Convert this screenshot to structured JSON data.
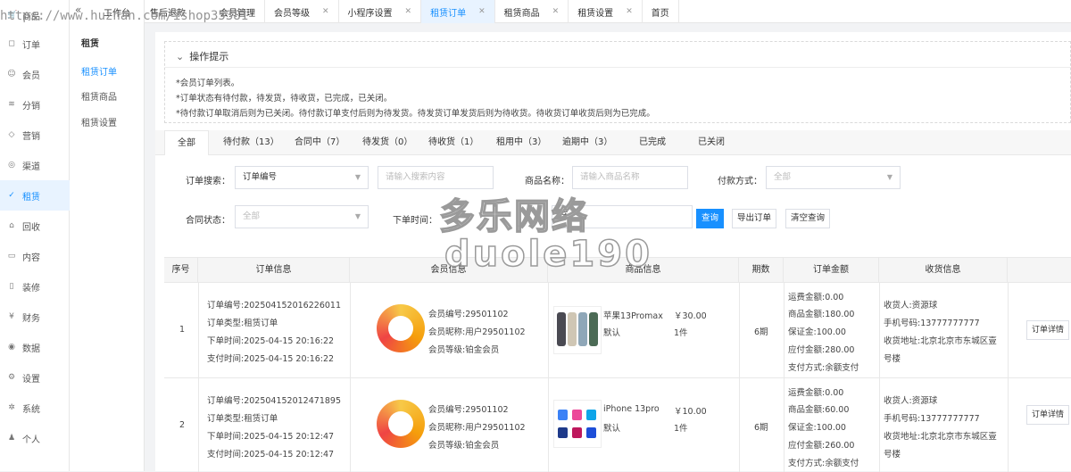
{
  "watermark": {
    "url": "https://www.huzhan.com/ishop35381",
    "title": "多乐网络",
    "sub": "duole190"
  },
  "sidebar": {
    "items": [
      {
        "label": "商品",
        "icon": "cart-icon"
      },
      {
        "label": "订单",
        "icon": "order-icon"
      },
      {
        "label": "会员",
        "icon": "user-icon"
      },
      {
        "label": "分销",
        "icon": "layers-icon"
      },
      {
        "label": "营销",
        "icon": "diamond-icon"
      },
      {
        "label": "渠道",
        "icon": "channel-icon"
      },
      {
        "label": "租赁",
        "icon": "check-shield-icon"
      },
      {
        "label": "回收",
        "icon": "recycle-cart-icon"
      },
      {
        "label": "内容",
        "icon": "book-icon"
      },
      {
        "label": "装修",
        "icon": "phone-icon"
      },
      {
        "label": "财务",
        "icon": "finance-icon"
      },
      {
        "label": "数据",
        "icon": "data-icon"
      },
      {
        "label": "设置",
        "icon": "gear-icon"
      },
      {
        "label": "系统",
        "icon": "system-icon"
      },
      {
        "label": "个人",
        "icon": "person-icon"
      }
    ],
    "active": "租赁"
  },
  "subnav": {
    "title": "租赁",
    "items": [
      "租赁订单",
      "租赁商品",
      "租赁设置"
    ],
    "active": "租赁订单"
  },
  "topbar": {
    "left": [
      "工作台",
      "售后退款",
      "会员管理"
    ],
    "tabs": [
      "会员等级",
      "小程序设置",
      "租赁订单",
      "租赁商品",
      "租赁设置",
      "首页"
    ],
    "active": "租赁订单"
  },
  "tips": {
    "header": "操作提示",
    "lines": [
      "*会员订单列表。",
      "*订单状态有待付款，待发货，待收货，已完成，已关闭。",
      "*待付款订单取消后则为已关闭。待付款订单支付后则为待发货。待发货订单发货后则为待收货。待收货订单收货后则为已完成。"
    ]
  },
  "status_tabs": [
    "全部",
    "待付款（13）",
    "合同中（7）",
    "待发货（0）",
    "待收货（1）",
    "租用中（3）",
    "逾期中（3）",
    "已完成",
    "已关闭"
  ],
  "filters": {
    "search_label": "订单搜索：",
    "search_type": "订单编号",
    "search_placeholder": "请输入搜索内容",
    "goods_label": "商品名称：",
    "goods_placeholder": "请输入商品名称",
    "pay_label": "付款方式：",
    "pay_value": "全部",
    "contract_label": "合同状态：",
    "contract_value": "全部",
    "time_label": "下单时间：",
    "time_sep": "至",
    "btn_query": "查询",
    "btn_export": "导出订单",
    "btn_clear": "清空查询"
  },
  "table": {
    "headers": [
      "序号",
      "订单信息",
      "会员信息",
      "商品信息",
      "期数",
      "订单金额",
      "收货信息"
    ],
    "rows": [
      {
        "index": "1",
        "order": [
          "订单编号:202504152016226011",
          "订单类型:租赁订单",
          "下单时间:2025-04-15 20:16:22",
          "支付时间:2025-04-15 20:16:22"
        ],
        "member": [
          "会员编号:29501102",
          "会员昵称:用户29501102",
          "会员等级:铂金会员"
        ],
        "goods": {
          "name": "苹果13Promax",
          "spec": "默认",
          "price": "￥30.00",
          "qty": "1件"
        },
        "period": "6期",
        "amount": [
          "运费金额:0.00",
          "商品金额:180.00",
          "保证金:100.00",
          "应付金额:280.00",
          "支付方式:余额支付"
        ],
        "ship": [
          "收货人:资源球",
          "手机号码:13777777777",
          "收货地址:北京北京市东城区壹",
          "号楼"
        ],
        "action": "订单详情"
      },
      {
        "index": "2",
        "order": [
          "订单编号:202504152012471895",
          "订单类型:租赁订单",
          "下单时间:2025-04-15 20:12:47",
          "支付时间:2025-04-15 20:12:47"
        ],
        "member": [
          "会员编号:29501102",
          "会员昵称:用户29501102",
          "会员等级:铂金会员"
        ],
        "goods": {
          "name": "iPhone 13pro",
          "spec": "默认",
          "price": "￥10.00",
          "qty": "1件"
        },
        "period": "6期",
        "amount": [
          "运费金额:0.00",
          "商品金额:60.00",
          "保证金:100.00",
          "应付金额:260.00",
          "支付方式:余额支付"
        ],
        "ship": [
          "收货人:资源球",
          "手机号码:13777777777",
          "收货地址:北京北京市东城区壹",
          "号楼"
        ],
        "action": "订单详情"
      }
    ]
  },
  "colors": {
    "accent": "#1890ff",
    "active_bg": "#e8f3ff"
  }
}
